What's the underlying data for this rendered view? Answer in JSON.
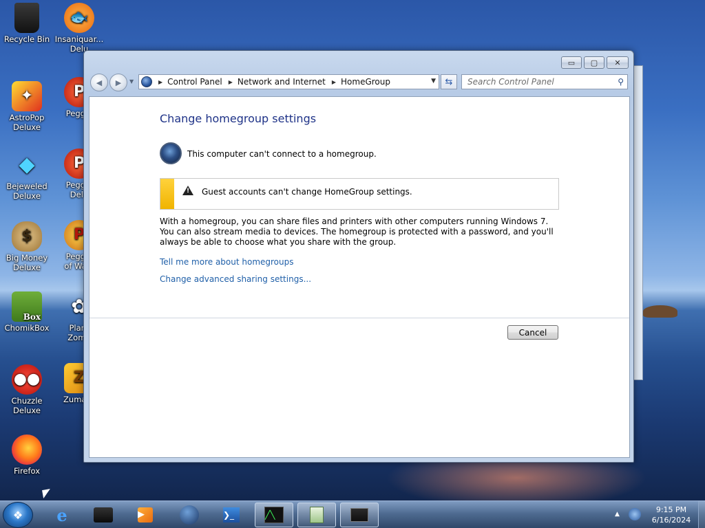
{
  "desktop": {
    "icons": [
      {
        "label": "Recycle Bin"
      },
      {
        "label": "Insaniquar...\nDelu"
      },
      {
        "label": "AstroPop\nDeluxe"
      },
      {
        "label": "Peggle"
      },
      {
        "label": "Bejeweled\nDeluxe"
      },
      {
        "label": "Peggle\nDelu"
      },
      {
        "label": "Big Money\nDeluxe"
      },
      {
        "label": "Peggle\nof Warc"
      },
      {
        "label": "ChomikBox"
      },
      {
        "label": "Plant\nZomb"
      },
      {
        "label": "Chuzzle\nDeluxe"
      },
      {
        "label": "Zuma D"
      },
      {
        "label": "Firefox"
      }
    ],
    "chomikbox_badge": "Box"
  },
  "window": {
    "controls": {
      "minimize": "▭",
      "maximize": "▢",
      "close": "✕"
    },
    "breadcrumbs": [
      "Control Panel",
      "Network and Internet",
      "HomeGroup"
    ],
    "search_placeholder": "Search Control Panel",
    "title": "Change homegroup settings",
    "status_text": "This computer can't connect to a homegroup.",
    "warning_text": "Guest accounts can't change HomeGroup settings.",
    "description": "With a homegroup, you can share files and printers with other computers running Windows 7. You can also stream media to devices. The homegroup is protected with a password, and you'll always be able to choose what you share with the group.",
    "links": {
      "learn_more": "Tell me more about homegroups",
      "advanced_sharing": "Change advanced sharing settings..."
    },
    "cancel_label": "Cancel"
  },
  "taskbar": {
    "time": "9:15 PM",
    "date": "6/16/2024"
  }
}
